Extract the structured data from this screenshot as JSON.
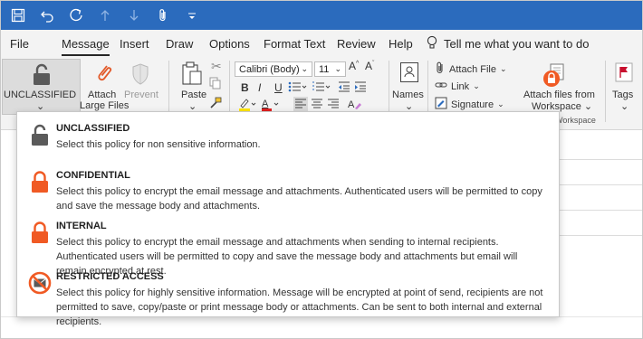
{
  "tabs": [
    "File",
    "Message",
    "Insert",
    "Draw",
    "Options",
    "Format Text",
    "Review",
    "Help"
  ],
  "tell_me": "Tell me what you want to do",
  "ribbon": {
    "classification_label": "UNCLASSIFIED",
    "attach_label_1": "Attach",
    "attach_label_2": "Large Files",
    "prevent_label": "Prevent",
    "paste_label": "Paste",
    "font_name": "Calibri (Body)",
    "font_size": "11",
    "bold": "B",
    "italic": "I",
    "underline": "U",
    "names_label": "Names",
    "attach_file": "Attach File",
    "link": "Link",
    "signature": "Signature",
    "attach_workspace_1": "Attach files from",
    "attach_workspace_2": "Workspace",
    "workspace_group": "Workspace",
    "tags_label": "Tags"
  },
  "options": [
    {
      "title": "UNCLASSIFIED",
      "desc": "Select this policy for non sensitive information.",
      "icon": "unlocked-padlock-icon"
    },
    {
      "title": "CONFIDENTIAL",
      "desc": "Select this policy to encrypt the email message and attachments. Authenticated users will be permitted to copy and save the message body and attachments.",
      "icon": "locked-padlock-icon"
    },
    {
      "title": "INTERNAL",
      "desc": "Select this policy to encrypt the email message and attachments when sending to internal recipients. Authenticated users will be permitted to copy and save the message body and attachments but email will remain encrypted at rest.",
      "icon": "locked-padlock-icon"
    },
    {
      "title": "RESTRICTED ACCESS",
      "desc": "Select this policy for highly sensitive information. Message will be encrypted at point of send, recipients are not permitted to save, copy/paste or print message body or attachments. Can be sent to both internal and external recipients.",
      "icon": "no-envelope-icon"
    }
  ],
  "colors": {
    "titlebar": "#2b6bbd",
    "lock_orange": "#f05a24",
    "lock_gray": "#5a5a5a"
  }
}
